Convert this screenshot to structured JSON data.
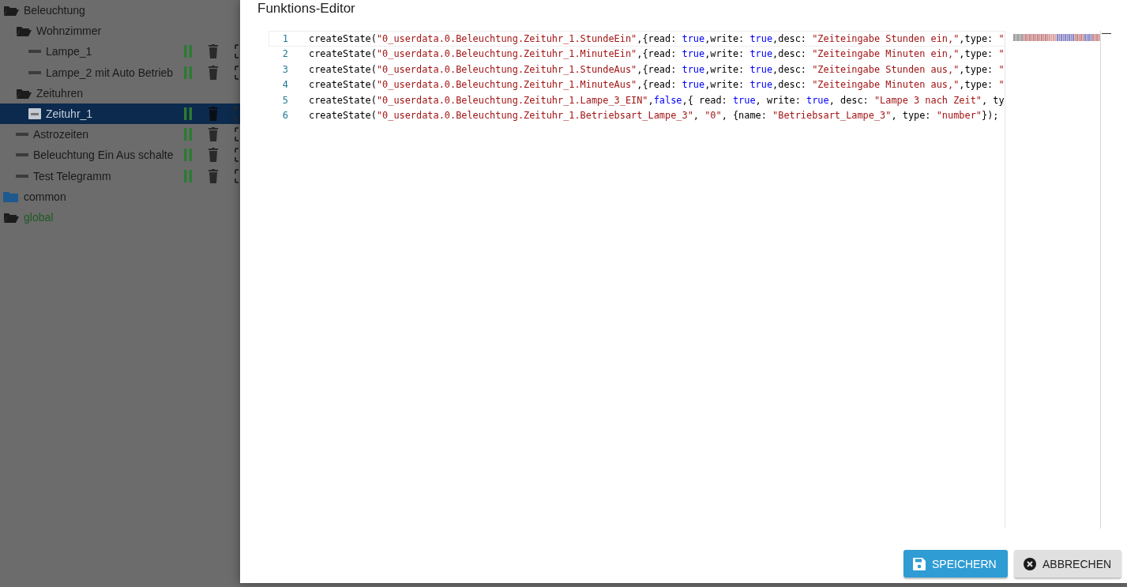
{
  "tree": [
    {
      "label": "Beleuchtung",
      "kind": "folder",
      "expanded": true,
      "color": "#1a1a1a",
      "children": [
        {
          "label": "Wohnzimmer",
          "kind": "folder",
          "expanded": true,
          "children": [
            {
              "label": "Lampe_1",
              "kind": "script",
              "selected": false
            },
            {
              "label": "Lampe_2 mit Auto Betrieb",
              "kind": "script",
              "selected": false
            }
          ]
        },
        {
          "label": "Zeituhren",
          "kind": "folder",
          "expanded": true,
          "children": [
            {
              "label": "Zeituhr_1",
              "kind": "script",
              "selected": true
            }
          ]
        },
        {
          "label": "Astrozeiten",
          "kind": "script",
          "selected": false
        },
        {
          "label": "Beleuchtung Ein Aus schalte",
          "kind": "script",
          "selected": false
        },
        {
          "label": "Test Telegramm",
          "kind": "script",
          "selected": false
        }
      ]
    },
    {
      "label": "common",
      "kind": "folder",
      "expanded": false,
      "color": "#1a1a1a"
    },
    {
      "label": "global",
      "kind": "folder",
      "expanded": true,
      "color": "#1f5a24"
    }
  ],
  "dialog": {
    "title": "Funktions-Editor",
    "code_lines": [
      {
        "number": "1",
        "tokens": [
          {
            "kind": "plain",
            "text": "createState("
          },
          {
            "kind": "string",
            "text": "\"0_userdata.0.Beleuchtung.Zeituhr_1.StundeEin\""
          },
          {
            "kind": "plain",
            "text": ",{read: "
          },
          {
            "kind": "keyword",
            "text": "true"
          },
          {
            "kind": "plain",
            "text": ",write: "
          },
          {
            "kind": "keyword",
            "text": "true"
          },
          {
            "kind": "plain",
            "text": ",desc: "
          },
          {
            "kind": "string",
            "text": "\"Zeiteingabe Stunden ein,\""
          },
          {
            "kind": "plain",
            "text": ",type: "
          },
          {
            "kind": "string",
            "text": "\""
          }
        ]
      },
      {
        "number": "2",
        "tokens": [
          {
            "kind": "plain",
            "text": "createState("
          },
          {
            "kind": "string",
            "text": "\"0_userdata.0.Beleuchtung.Zeituhr_1.MinuteEin\""
          },
          {
            "kind": "plain",
            "text": ",{read: "
          },
          {
            "kind": "keyword",
            "text": "true"
          },
          {
            "kind": "plain",
            "text": ",write: "
          },
          {
            "kind": "keyword",
            "text": "true"
          },
          {
            "kind": "plain",
            "text": ",desc: "
          },
          {
            "kind": "string",
            "text": "\"Zeiteingabe Minuten ein,\""
          },
          {
            "kind": "plain",
            "text": ",type: "
          },
          {
            "kind": "string",
            "text": "\""
          }
        ]
      },
      {
        "number": "3",
        "tokens": [
          {
            "kind": "plain",
            "text": "createState("
          },
          {
            "kind": "string",
            "text": "\"0_userdata.0.Beleuchtung.Zeituhr_1.StundeAus\""
          },
          {
            "kind": "plain",
            "text": ",{read: "
          },
          {
            "kind": "keyword",
            "text": "true"
          },
          {
            "kind": "plain",
            "text": ",write: "
          },
          {
            "kind": "keyword",
            "text": "true"
          },
          {
            "kind": "plain",
            "text": ",desc: "
          },
          {
            "kind": "string",
            "text": "\"Zeiteingabe Stunden aus,\""
          },
          {
            "kind": "plain",
            "text": ",type: "
          },
          {
            "kind": "string",
            "text": "\""
          }
        ]
      },
      {
        "number": "4",
        "tokens": [
          {
            "kind": "plain",
            "text": "createState("
          },
          {
            "kind": "string",
            "text": "\"0_userdata.0.Beleuchtung.Zeituhr_1.MinuteAus\""
          },
          {
            "kind": "plain",
            "text": ",{read: "
          },
          {
            "kind": "keyword",
            "text": "true"
          },
          {
            "kind": "plain",
            "text": ",write: "
          },
          {
            "kind": "keyword",
            "text": "true"
          },
          {
            "kind": "plain",
            "text": ",desc: "
          },
          {
            "kind": "string",
            "text": "\"Zeiteingabe Minuten aus,\""
          },
          {
            "kind": "plain",
            "text": ",type: "
          },
          {
            "kind": "string",
            "text": "\""
          }
        ]
      },
      {
        "number": "5",
        "tokens": [
          {
            "kind": "plain",
            "text": "createState("
          },
          {
            "kind": "string",
            "text": "\"0_userdata.0.Beleuchtung.Zeituhr_1.Lampe_3_EIN\""
          },
          {
            "kind": "plain",
            "text": ","
          },
          {
            "kind": "keyword",
            "text": "false"
          },
          {
            "kind": "plain",
            "text": ",{ read: "
          },
          {
            "kind": "keyword",
            "text": "true"
          },
          {
            "kind": "plain",
            "text": ", write: "
          },
          {
            "kind": "keyword",
            "text": "true"
          },
          {
            "kind": "plain",
            "text": ", desc: "
          },
          {
            "kind": "string",
            "text": "\"Lampe 3 nach Zeit\""
          },
          {
            "kind": "plain",
            "text": ", ty"
          }
        ]
      },
      {
        "number": "6",
        "tokens": [
          {
            "kind": "plain",
            "text": "createState("
          },
          {
            "kind": "string",
            "text": "\"0_userdata.0.Beleuchtung.Zeituhr_1.Betriebsart_Lampe_3\""
          },
          {
            "kind": "plain",
            "text": ", "
          },
          {
            "kind": "string",
            "text": "\"0\""
          },
          {
            "kind": "plain",
            "text": ", {name: "
          },
          {
            "kind": "string",
            "text": "\"Betriebsart_Lampe_3\""
          },
          {
            "kind": "plain",
            "text": ", type: "
          },
          {
            "kind": "string",
            "text": "\"number\""
          },
          {
            "kind": "plain",
            "text": "});"
          }
        ]
      }
    ],
    "buttons": [
      {
        "label": "SPEICHERN",
        "kind": "save"
      },
      {
        "label": "ABBRECHEN",
        "kind": "cancel"
      }
    ]
  }
}
